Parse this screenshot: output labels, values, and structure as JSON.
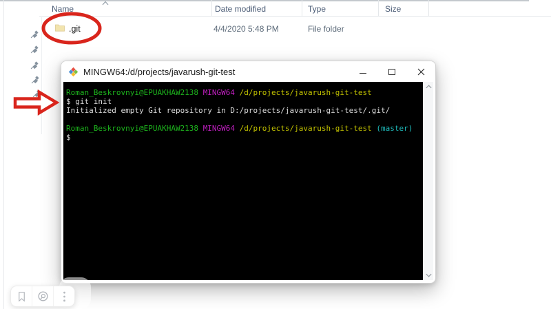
{
  "explorer": {
    "columns": [
      {
        "label": "Name"
      },
      {
        "label": "Date modified"
      },
      {
        "label": "Type"
      },
      {
        "label": "Size"
      }
    ],
    "row": {
      "name": ".git",
      "date_modified": "4/4/2020 5:48 PM",
      "type": "File folder",
      "size": ""
    },
    "sort_icon": "chevron-up-icon",
    "row_icon": "folder-icon"
  },
  "terminal": {
    "title": "MINGW64:/d/projects/javarush-git-test",
    "app_icon": "git-bash-diamond-icon",
    "controls": [
      "minimize",
      "maximize",
      "close"
    ],
    "colors": {
      "green": "#1db41d",
      "magenta": "#c11fc1",
      "yellow": "#c3c300",
      "cyan": "#1fbdbd",
      "foreground": "#dcdcdc",
      "background": "#000000"
    },
    "lines": [
      {
        "segments": [
          {
            "text": "Roman_Beskrovnyi@EPUAKHAW2138 ",
            "color": "green"
          },
          {
            "text": "MINGW64 ",
            "color": "magenta"
          },
          {
            "text": "/d/projects/javarush-git-test",
            "color": "yellow"
          }
        ]
      },
      {
        "segments": [
          {
            "text": "$ git init",
            "color": "foreground"
          }
        ]
      },
      {
        "segments": [
          {
            "text": "Initialized empty Git repository in D:/projects/javarush-git-test/.git/",
            "color": "foreground"
          }
        ]
      },
      {
        "segments": []
      },
      {
        "segments": [
          {
            "text": "Roman_Beskrovnyi@EPUAKHAW2138 ",
            "color": "green"
          },
          {
            "text": "MINGW64 ",
            "color": "magenta"
          },
          {
            "text": "/d/projects/javarush-git-test ",
            "color": "yellow"
          },
          {
            "text": "(master)",
            "color": "cyan"
          }
        ]
      },
      {
        "segments": [
          {
            "text": "$",
            "color": "foreground"
          }
        ]
      }
    ]
  },
  "annotations": {
    "color": "#d9251c",
    "shapes": [
      "ellipse-around-git-folder",
      "arrow-pointing-to-terminal"
    ],
    "pin_icon": "pushpin-icon",
    "pin_count": 5
  },
  "mini_toolbar": {
    "icons": [
      "bookmark-icon",
      "screenshot-search-icon",
      "kebab-menu-icon"
    ]
  }
}
